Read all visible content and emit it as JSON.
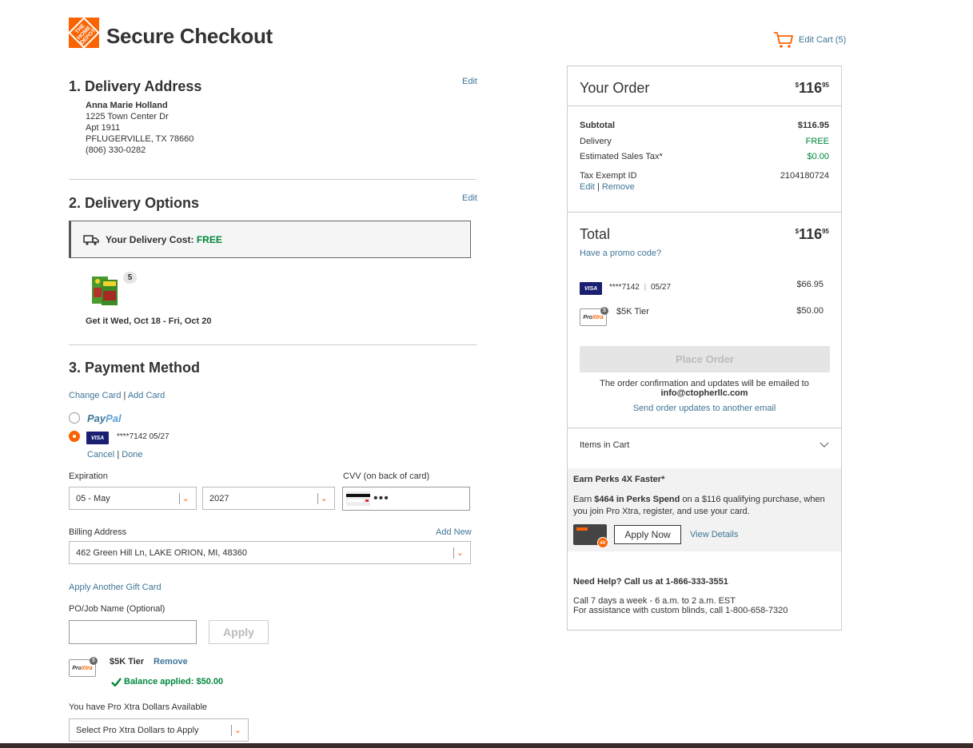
{
  "header": {
    "logo_text": "THE HOME DEPOT",
    "title": "Secure Checkout",
    "edit_cart": "Edit Cart",
    "cart_count": "(5)"
  },
  "delivery_address": {
    "heading": "1. Delivery Address",
    "edit": "Edit",
    "name": "Anna Marie Holland",
    "line1": "1225 Town Center Dr",
    "line2": "Apt 1911",
    "city": "PFLUGERVILLE, TX 78660",
    "phone": "(806) 330-0282"
  },
  "delivery_options": {
    "heading": "2. Delivery Options",
    "edit": "Edit",
    "cost_label": "Your Delivery Cost:",
    "cost_value": "FREE",
    "quantity": "5",
    "get_it": "Get it Wed, Oct 18 - Fri, Oct 20"
  },
  "payment": {
    "heading": "3. Payment Method",
    "change_card": "Change Card",
    "add_card": "Add Card",
    "sep": "|",
    "paypal_a": "Pay",
    "paypal_b": "Pal",
    "visa": "VISA",
    "card_mask": "****7142",
    "card_exp": "05/27",
    "cancel": "Cancel",
    "done": "Done",
    "expiration_label": "Expiration",
    "exp_month": "05 - May",
    "exp_year": "2027",
    "cvv_label": "CVV (on back of card)",
    "cvv_dots": "•••",
    "billing_label": "Billing Address",
    "add_new": "Add New",
    "billing_value": "462 Green Hill Ln, LAKE ORION, MI, 48360",
    "gift_card": "Apply Another Gift Card",
    "po_label": "PO/Job Name (Optional)",
    "apply": "Apply",
    "proxtra_a": "Pro",
    "proxtra_b": "Xtra",
    "tier": "$5K Tier",
    "remove": "Remove",
    "balance": "Balance applied: $50.00",
    "pro_dollars_label": "You have Pro Xtra Dollars Available",
    "pro_dollars_select": "Select Pro Xtra Dollars to Apply"
  },
  "order": {
    "heading": "Your Order",
    "total_dollars": "116",
    "total_cents": "95",
    "currency": "$",
    "subtotal_label": "Subtotal",
    "subtotal_value": "$116.95",
    "delivery_label": "Delivery",
    "delivery_value": "FREE",
    "tax_label": "Estimated Sales Tax*",
    "tax_value": "$0.00",
    "tax_exempt_label": "Tax Exempt ID",
    "tax_exempt_value": "2104180724",
    "edit": "Edit",
    "remove": "Remove",
    "total_label": "Total",
    "promo": "Have a promo code?",
    "visa": "VISA",
    "card_mask": "****7142",
    "card_exp": "05/27",
    "card_amount": "$66.95",
    "tier": "$5K Tier",
    "tier_amount": "$50.00",
    "place_order": "Place Order",
    "email_note": "The order confirmation and updates will be emailed to",
    "email": "info@ctopherllc.com",
    "send_updates": "Send order updates to another email",
    "items_in_cart": "Items in Cart",
    "perks_title": "Earn Perks 4X Faster*",
    "perks_text_1": "Earn ",
    "perks_bold": "$464 in Perks Spend",
    "perks_text_2": " on a $116 qualifying purchase, when you join Pro Xtra, register, and use your card.",
    "apply_now": "Apply Now",
    "view_details": "View Details",
    "fourx": "4X",
    "help_title": "Need Help? Call us at 1-866-333-3551",
    "help_line1": "Call 7 days a week - 6 a.m. to 2 a.m. EST",
    "help_line2": "For assistance with custom blinds, call 1-800-658-7320"
  },
  "colors": {
    "brand": "#f96302",
    "link": "#3e7697",
    "free": "#00873c",
    "visa": "#1a1f71"
  }
}
